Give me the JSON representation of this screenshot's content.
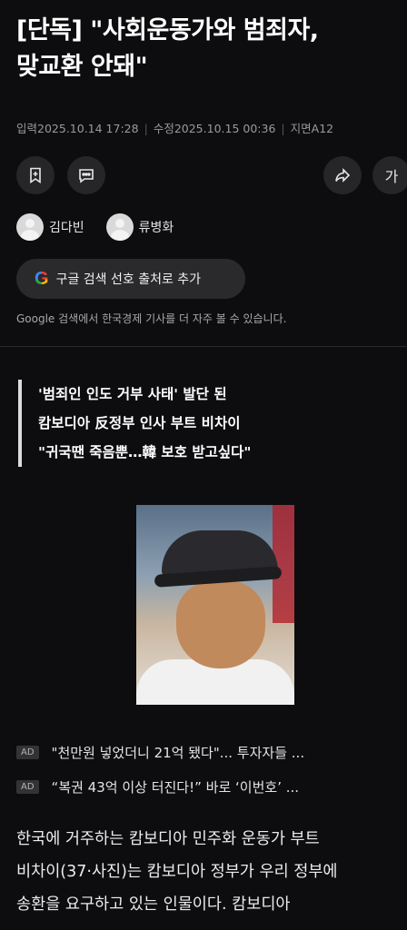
{
  "article": {
    "headline_line1": "[단독] \"사회운동가와 범죄자,",
    "headline_line2": "맞교환 안돼\"",
    "input_label": "입력",
    "input_time": "2025.10.14 17:28",
    "edit_label": "수정",
    "edit_time": "2025.10.15 00:36",
    "page_label": "지면",
    "page_no": "A12"
  },
  "toolbar": {
    "font_label": "가"
  },
  "reporters": [
    {
      "name": "김다빈"
    },
    {
      "name": "류병화"
    }
  ],
  "google": {
    "logo_letter": "G",
    "button_label": "구글 검색 선호 출처로 추가",
    "note": "Google 검색에서 한국경제 기사를 더 자주 볼 수 있습니다."
  },
  "subhead": [
    "'범죄인 인도 거부 사태' 발단 된",
    "캄보디아 反정부 인사 부트 비차이",
    "\"귀국땐 죽음뿐…韓 보호 받고싶다\""
  ],
  "ads": [
    {
      "badge": "AD",
      "text": "\"천만원 넣었더니 21억 됐다\"... 투자자들 ..."
    },
    {
      "badge": "AD",
      "text": "“복권 43억 이상 터진다!” 바로 ‘이번호’ ..."
    }
  ],
  "body": {
    "line1": "한국에 거주하는 캄보디아 민주화 운동가 부트",
    "line2": "비차이(37·사진)는 캄보디아 정부가 우리 정부에",
    "line3": "송환을 요구하고 있는 인물이다. 캄보디아"
  }
}
